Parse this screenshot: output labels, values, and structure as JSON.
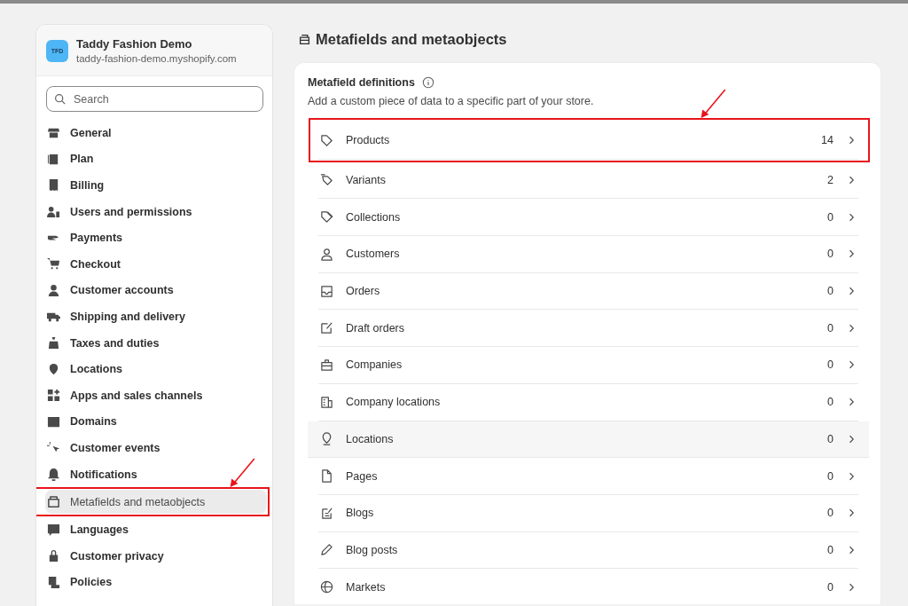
{
  "store": {
    "initials": "TFD",
    "name": "Taddy Fashion Demo",
    "domain": "taddy-fashion-demo.myshopify.com"
  },
  "search": {
    "placeholder": "Search"
  },
  "sidebar": {
    "items": [
      {
        "label": "General",
        "selected": false,
        "annotated": false
      },
      {
        "label": "Plan",
        "selected": false,
        "annotated": false
      },
      {
        "label": "Billing",
        "selected": false,
        "annotated": false
      },
      {
        "label": "Users and permissions",
        "selected": false,
        "annotated": false
      },
      {
        "label": "Payments",
        "selected": false,
        "annotated": false
      },
      {
        "label": "Checkout",
        "selected": false,
        "annotated": false
      },
      {
        "label": "Customer accounts",
        "selected": false,
        "annotated": false
      },
      {
        "label": "Shipping and delivery",
        "selected": false,
        "annotated": false
      },
      {
        "label": "Taxes and duties",
        "selected": false,
        "annotated": false
      },
      {
        "label": "Locations",
        "selected": false,
        "annotated": false
      },
      {
        "label": "Apps and sales channels",
        "selected": false,
        "annotated": false
      },
      {
        "label": "Domains",
        "selected": false,
        "annotated": false
      },
      {
        "label": "Customer events",
        "selected": false,
        "annotated": false
      },
      {
        "label": "Notifications",
        "selected": false,
        "annotated": false
      },
      {
        "label": "Metafields and metaobjects",
        "selected": true,
        "annotated": true
      },
      {
        "label": "Languages",
        "selected": false,
        "annotated": false
      },
      {
        "label": "Customer privacy",
        "selected": false,
        "annotated": false
      },
      {
        "label": "Policies",
        "selected": false,
        "annotated": false
      }
    ]
  },
  "page": {
    "title": "Metafields and metaobjects"
  },
  "definitions": {
    "title": "Metafield definitions",
    "description": "Add a custom piece of data to a specific part of your store.",
    "rows": [
      {
        "label": "Products",
        "count": "14",
        "hovered": false,
        "annotated": true
      },
      {
        "label": "Variants",
        "count": "2",
        "hovered": false,
        "annotated": false
      },
      {
        "label": "Collections",
        "count": "0",
        "hovered": false,
        "annotated": false
      },
      {
        "label": "Customers",
        "count": "0",
        "hovered": false,
        "annotated": false
      },
      {
        "label": "Orders",
        "count": "0",
        "hovered": false,
        "annotated": false
      },
      {
        "label": "Draft orders",
        "count": "0",
        "hovered": false,
        "annotated": false
      },
      {
        "label": "Companies",
        "count": "0",
        "hovered": false,
        "annotated": false
      },
      {
        "label": "Company locations",
        "count": "0",
        "hovered": false,
        "annotated": false
      },
      {
        "label": "Locations",
        "count": "0",
        "hovered": true,
        "annotated": false
      },
      {
        "label": "Pages",
        "count": "0",
        "hovered": false,
        "annotated": false
      },
      {
        "label": "Blogs",
        "count": "0",
        "hovered": false,
        "annotated": false
      },
      {
        "label": "Blog posts",
        "count": "0",
        "hovered": false,
        "annotated": false
      },
      {
        "label": "Markets",
        "count": "0",
        "hovered": false,
        "annotated": false
      }
    ]
  }
}
